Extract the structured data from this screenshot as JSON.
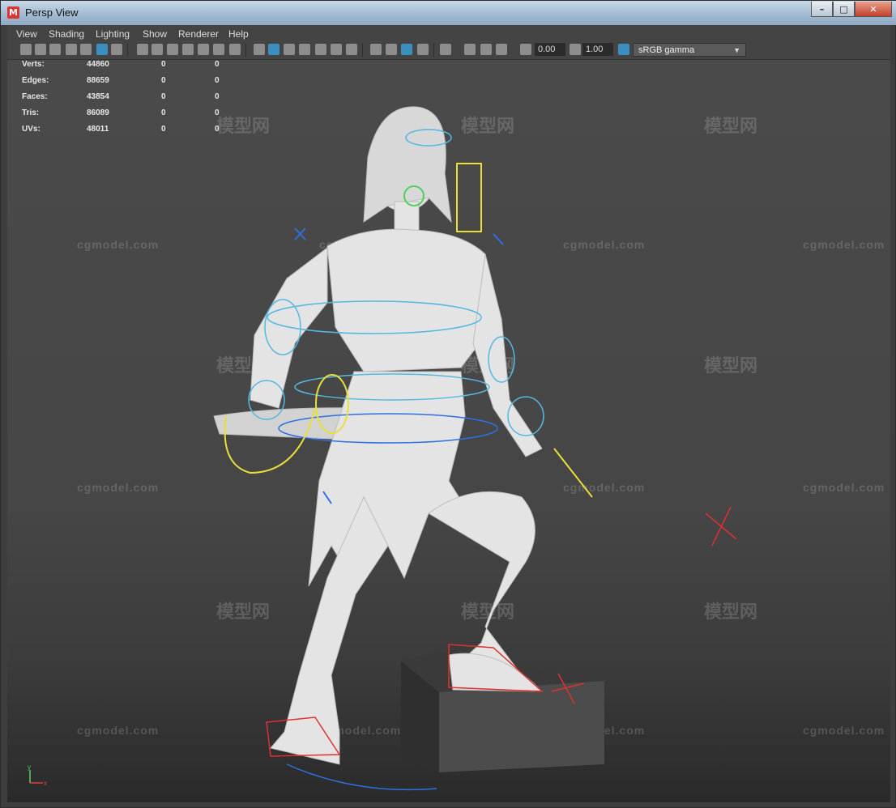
{
  "window": {
    "title": "Persp View",
    "app_icon": "M"
  },
  "menu": [
    "View",
    "Shading",
    "Lighting",
    "Show",
    "Renderer",
    "Help"
  ],
  "toolbar": {
    "exposure": "0.00",
    "gamma": "1.00",
    "color_space": "sRGB gamma"
  },
  "hud": {
    "rows": [
      {
        "label": "Verts:",
        "value": "44860",
        "sel": "0",
        "uv": "0"
      },
      {
        "label": "Edges:",
        "value": "88659",
        "sel": "0",
        "uv": "0"
      },
      {
        "label": "Faces:",
        "value": "43854",
        "sel": "0",
        "uv": "0"
      },
      {
        "label": "Tris:",
        "value": "86089",
        "sel": "0",
        "uv": "0"
      },
      {
        "label": "UVs:",
        "value": "48011",
        "sel": "0",
        "uv": "0"
      }
    ]
  },
  "watermark": {
    "site": "cgmodel.com",
    "cn": "模型网"
  },
  "axis": {
    "x": "x",
    "y": "y"
  }
}
